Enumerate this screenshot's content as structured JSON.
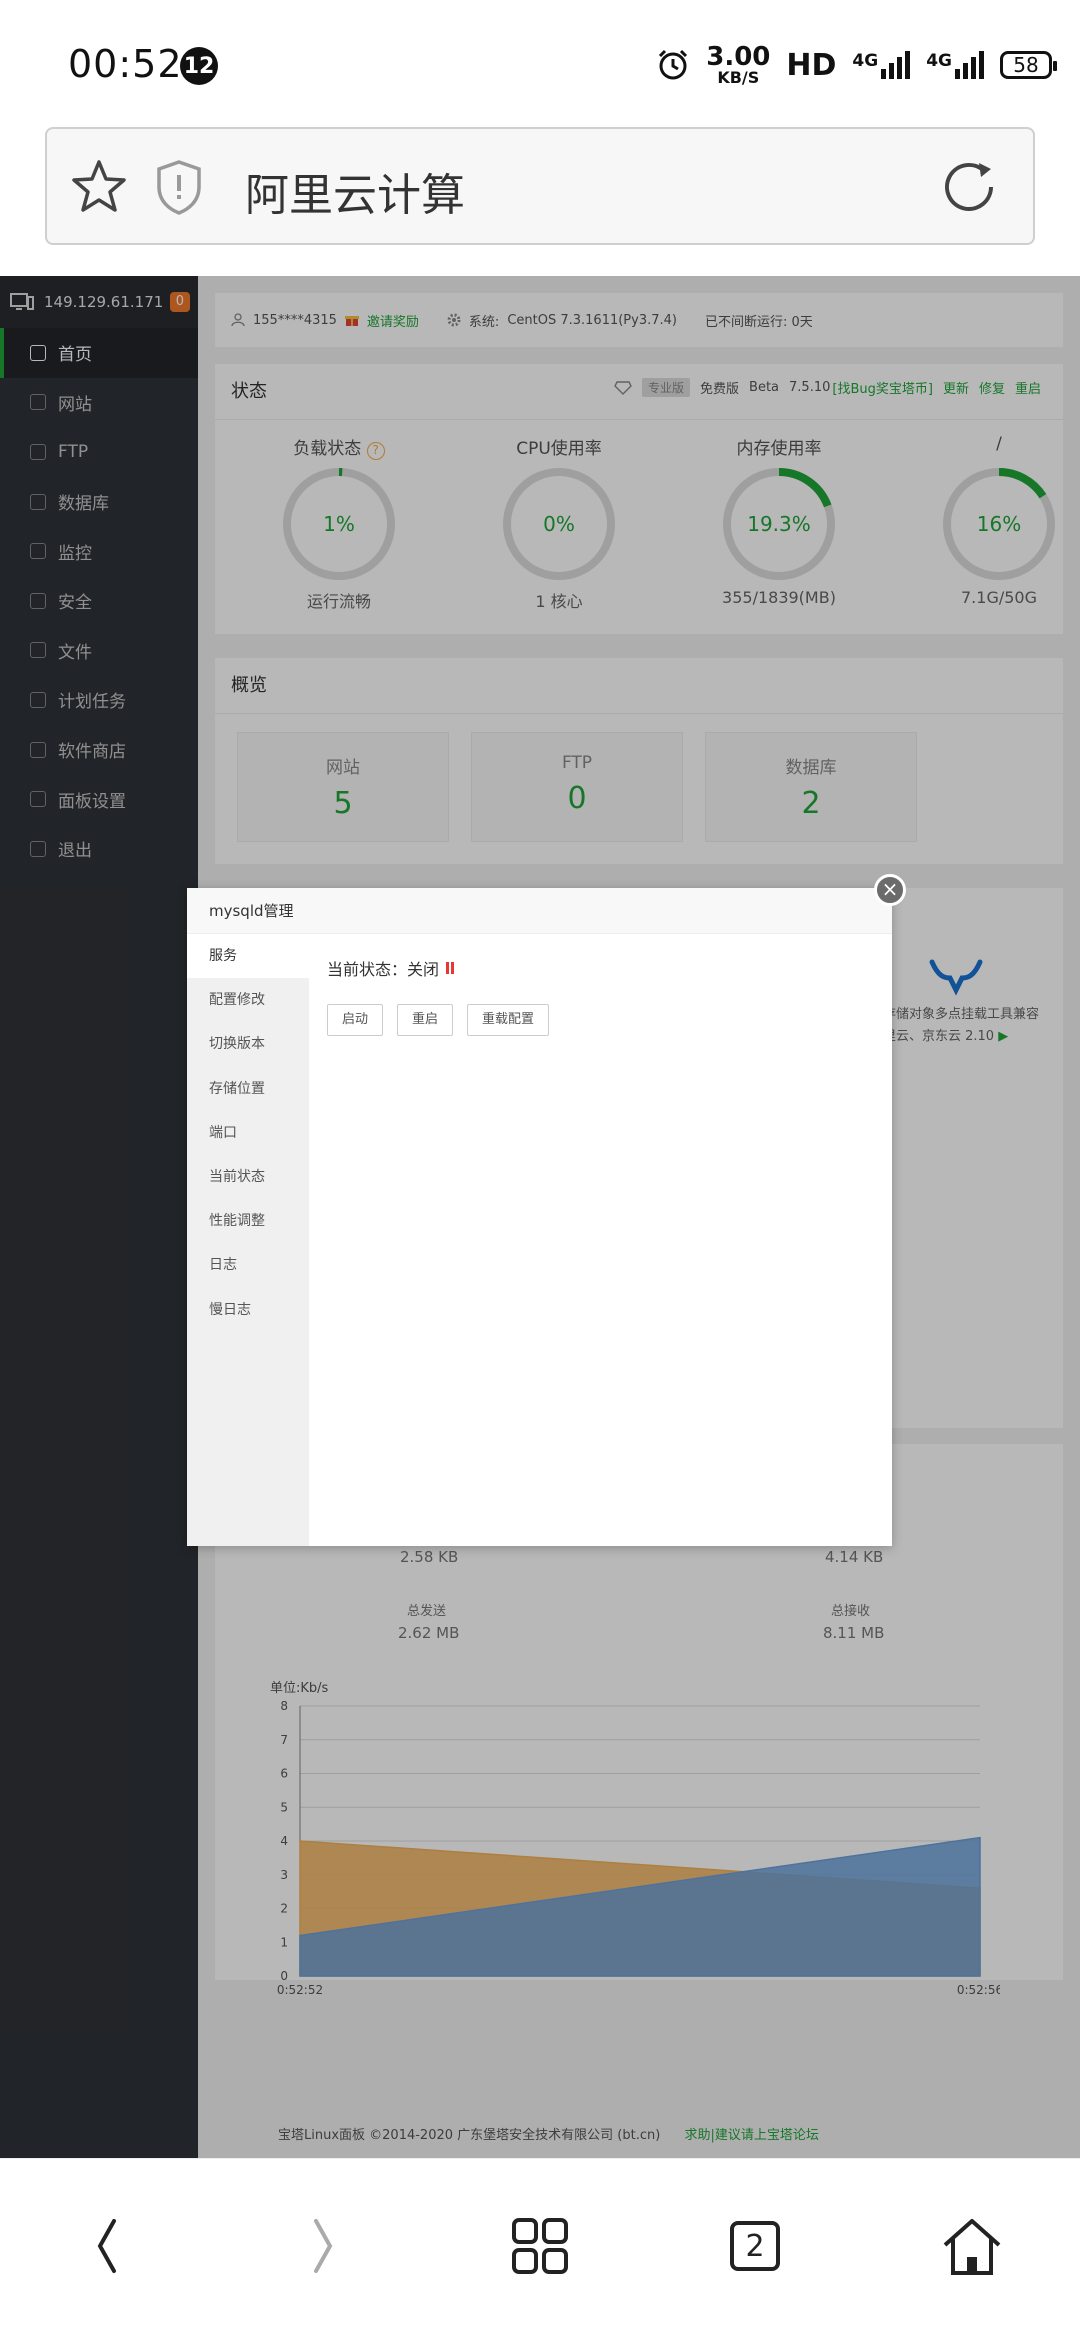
{
  "status_bar": {
    "time": "00:52",
    "notif_count": "12",
    "speed_value": "3.00",
    "speed_unit": "KB/S",
    "hd": "HD",
    "net1": "4G",
    "net2": "4G",
    "battery": "58"
  },
  "address_bar": {
    "title": "阿里云计算"
  },
  "sidebar": {
    "ip": "149.129.61.171",
    "badge": "0",
    "items": [
      {
        "label": "首页"
      },
      {
        "label": "网站"
      },
      {
        "label": "FTP"
      },
      {
        "label": "数据库"
      },
      {
        "label": "监控"
      },
      {
        "label": "安全"
      },
      {
        "label": "文件"
      },
      {
        "label": "计划任务"
      },
      {
        "label": "软件商店"
      },
      {
        "label": "面板设置"
      },
      {
        "label": "退出"
      }
    ]
  },
  "topinfo": {
    "user": "155****4315",
    "invite": "邀请奖励",
    "system_label": "系统:",
    "system_value": "CentOS 7.3.1611(Py3.7.4)",
    "uptime": "已不间断运行: 0天"
  },
  "status_panel": {
    "title": "状态",
    "version": {
      "pro": "专业版",
      "free": "免费版",
      "beta": "Beta",
      "num": "7.5.10",
      "bug": "[找Bug奖宝塔币]",
      "update": "更新",
      "repair": "修复",
      "restart": "重启"
    },
    "gauges": [
      {
        "label": "负载状态",
        "value": "1%",
        "sub": "运行流畅",
        "percent": 1,
        "color": "#20a53a"
      },
      {
        "label": "CPU使用率",
        "value": "0%",
        "sub": "1 核心",
        "percent": 0,
        "color": "#20a53a"
      },
      {
        "label": "内存使用率",
        "value": "19.3%",
        "sub": "355/1839(MB)",
        "percent": 19.3,
        "color": "#20a53a"
      },
      {
        "label": "/",
        "value": "16%",
        "sub": "7.1G/50G",
        "percent": 16,
        "color": "#20a53a"
      }
    ]
  },
  "overview_panel": {
    "title": "概览",
    "boxes": [
      {
        "label": "网站",
        "value": "5"
      },
      {
        "label": "FTP",
        "value": "0"
      },
      {
        "label": "数据库",
        "value": "2"
      }
    ]
  },
  "side_ad": {
    "line1": "云存储对象多点挂载工具兼容",
    "line2": "阿里云、京东云 2.10"
  },
  "dialog": {
    "title": "mysqld管理",
    "close": "×",
    "tabs": [
      {
        "label": "服务"
      },
      {
        "label": "配置修改"
      },
      {
        "label": "切换版本"
      },
      {
        "label": "存储位置"
      },
      {
        "label": "端口"
      },
      {
        "label": "当前状态"
      },
      {
        "label": "性能调整"
      },
      {
        "label": "日志"
      },
      {
        "label": "慢日志"
      }
    ],
    "status_text": "当前状态：关闭",
    "buttons": {
      "start": "启动",
      "restart": "重启",
      "reload": "重载配置"
    }
  },
  "traffic": {
    "up_now": "2.58 KB",
    "down_now": "4.14 KB",
    "total_send_label": "总发送",
    "total_send": "2.62 MB",
    "total_recv_label": "总接收",
    "total_recv": "8.11 MB"
  },
  "chart_data": {
    "type": "area",
    "ylabel": "单位:Kb/s",
    "x": [
      "0:52:52",
      "0:52:56"
    ],
    "ylim": [
      0,
      8
    ],
    "yticks": [
      0,
      1,
      2,
      3,
      4,
      5,
      6,
      7,
      8
    ],
    "series": [
      {
        "values": [
          4.0,
          2.6
        ],
        "color": "#f0b05a"
      },
      {
        "values": [
          1.2,
          4.1
        ],
        "color": "#6b9fd8"
      }
    ]
  },
  "footer": {
    "text": "宝塔Linux面板 ©2014-2020 广东堡塔安全技术有限公司 (bt.cn)",
    "link": "求助|建议请上宝塔论坛"
  },
  "bottom_nav": {
    "tabs_count": "2"
  }
}
